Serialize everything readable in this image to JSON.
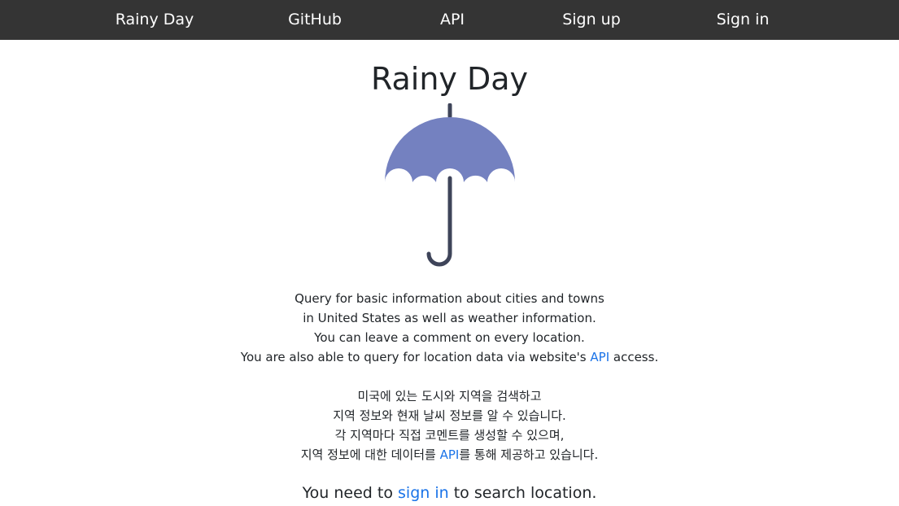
{
  "nav": {
    "brand": "Rainy Day",
    "github": "GitHub",
    "api": "API",
    "signup": "Sign up",
    "signin": "Sign in"
  },
  "main": {
    "title": "Rainy Day",
    "umbrella_icon": "umbrella-icon",
    "umbrella_colors": {
      "canopy": "#7481c0",
      "handle": "#3e4459"
    },
    "description_en": {
      "line1": "Query for basic information about cities and towns",
      "line2": "in United States as well as weather information.",
      "line3": "You can leave a comment on every location.",
      "line4_before": "You are also able to query for location data via website's ",
      "line4_link": "API",
      "line4_after": " access."
    },
    "description_kr": {
      "line1": "미국에 있는 도시와 지역을 검색하고",
      "line2": "지역 정보와 현재 날씨 정보를 알 수 있습니다.",
      "line3": "각 지역마다 직접 코멘트를 생성할 수 있으며,",
      "line4_before": "지역 정보에 대한 데이터를 ",
      "line4_link": "API",
      "line4_after": "를 통해 제공하고 있습니다."
    },
    "signin_prompt": {
      "before": "You need to ",
      "link": "sign in",
      "after": " to search location."
    }
  },
  "colors": {
    "navbar_bg": "#343434",
    "link": "#1a73e8"
  }
}
